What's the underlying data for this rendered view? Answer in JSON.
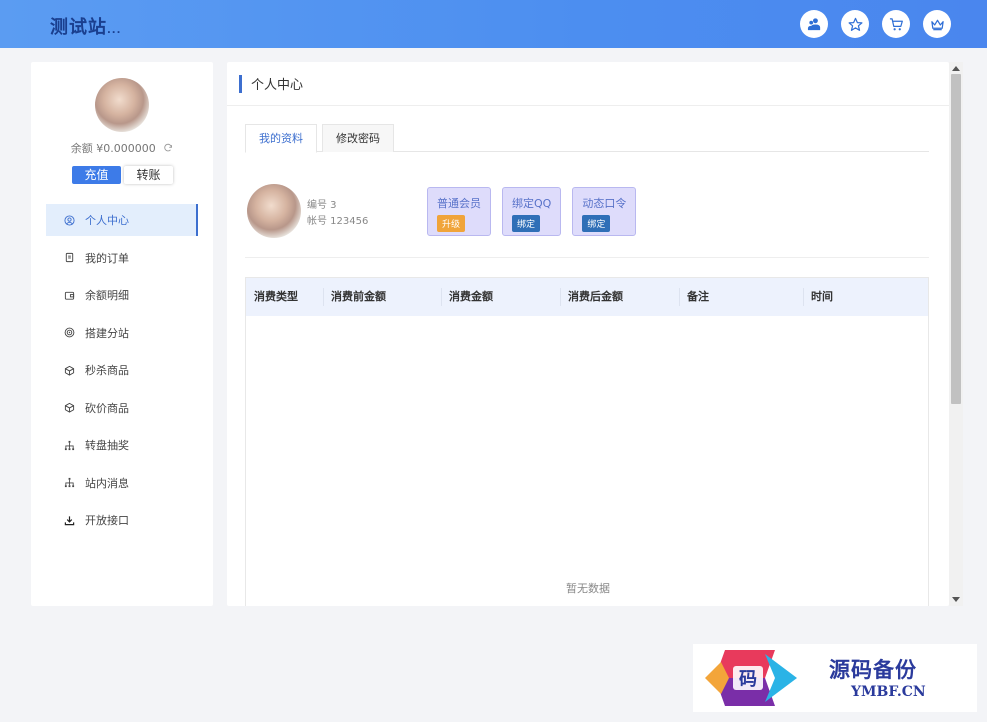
{
  "header": {
    "brand": "测试站",
    "brand_suffix": "...",
    "icons": [
      "users-icon",
      "star-icon",
      "cart-icon",
      "crown-icon"
    ]
  },
  "sidebar": {
    "balance": "余额 ¥0.000000",
    "refresh_icon": "refresh-icon",
    "recharge_label": "充值",
    "transfer_label": "转账",
    "items": [
      {
        "label": "个人中心",
        "icon": "user-circle-icon",
        "active": true
      },
      {
        "label": "我的订单",
        "icon": "receipt-icon"
      },
      {
        "label": "余额明细",
        "icon": "wallet-icon"
      },
      {
        "label": "搭建分站",
        "icon": "network-icon"
      },
      {
        "label": "秒杀商品",
        "icon": "box-icon"
      },
      {
        "label": "砍价商品",
        "icon": "box-icon"
      },
      {
        "label": "转盘抽奖",
        "icon": "sitemap-icon"
      },
      {
        "label": "站内消息",
        "icon": "sitemap-icon"
      },
      {
        "label": "开放接口",
        "icon": "download-icon"
      }
    ]
  },
  "main": {
    "title": "个人中心",
    "tabs": [
      {
        "label": "我的资料",
        "active": true
      },
      {
        "label": "修改密码"
      }
    ],
    "profile": {
      "id_label": "编号 3",
      "account_label": "帐号 123456"
    },
    "cards": [
      {
        "title": "普通会员",
        "badge": "升级",
        "badge_color": "#f0a43a"
      },
      {
        "title": "绑定QQ",
        "badge": "绑定",
        "badge_color": "#2f6fb7"
      },
      {
        "title": "动态口令",
        "badge": "绑定",
        "badge_color": "#2f6fb7"
      }
    ],
    "table": {
      "columns": [
        "消费类型",
        "消费前金额",
        "消费金额",
        "消费后金额",
        "备注",
        "时间"
      ],
      "rows": [],
      "empty_text": "暂无数据"
    }
  },
  "watermark": {
    "logo_char": "码",
    "title": "源码备份",
    "domain": "YMBF.CN"
  },
  "colors": {
    "accent": "#3d6fcf",
    "header_bg": "#4c8ef0",
    "card_bg": "#dedcfb"
  }
}
